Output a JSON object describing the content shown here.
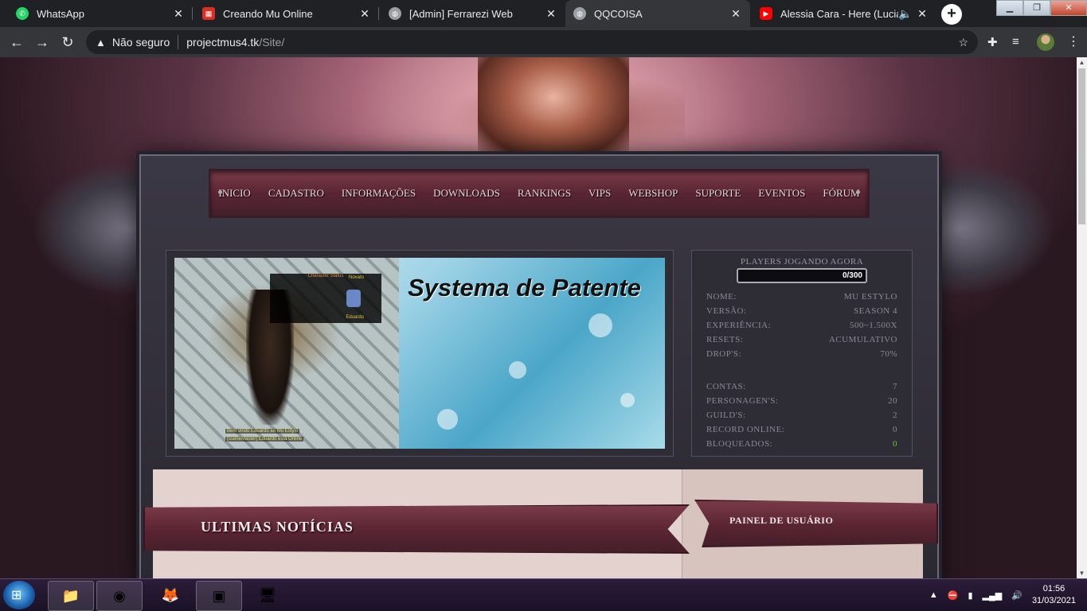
{
  "browser": {
    "tabs": [
      {
        "title": "WhatsApp",
        "icon": "whatsapp-icon",
        "color": "#25d366",
        "active": false
      },
      {
        "title": "Creando Mu Online",
        "icon": "calendar-icon",
        "color": "#d93025",
        "active": false
      },
      {
        "title": "[Admin] Ferrarezi Web",
        "icon": "globe-icon",
        "color": "#9aa0a6",
        "active": false
      },
      {
        "title": "QQCOISA",
        "icon": "globe-icon",
        "color": "#9aa0a6",
        "active": true
      },
      {
        "title": "Alessia Cara - Here (Lucian",
        "icon": "youtube-icon",
        "color": "#ff0000",
        "active": false
      }
    ],
    "address": {
      "security": "Não seguro",
      "host": "projectmus4.tk",
      "path": "/Site/"
    }
  },
  "site": {
    "nav": [
      "INICIO",
      "CADASTRO",
      "INFORMAÇÕES",
      "DOWNLOADS",
      "RANKINGS",
      "VIPS",
      "WEBSHOP",
      "SUPORTE",
      "EVENTOS",
      "FÓRUM"
    ],
    "banner": {
      "title": "Systema de Patente",
      "status_header": "Character Status",
      "rank": "Novato",
      "name": "Eduardo",
      "welcome": "Bem vindo Eduardo ao Mu Estylo",
      "welcome2": "[GameMaster] Eduardo está Online"
    },
    "players": {
      "label": "PLAYERS JOGANDO AGORA",
      "text": "0/300",
      "fraction": 0
    },
    "server_info": [
      {
        "label": "NOME:",
        "value": "MU ESTYLO"
      },
      {
        "label": "VERSÃO:",
        "value": "SEASON 4"
      },
      {
        "label": "EXPERIÊNCIA:",
        "value": "500~1.500X"
      },
      {
        "label": "RESETS:",
        "value": "ACUMULATIVO"
      },
      {
        "label": "DROP'S:",
        "value": "70%"
      }
    ],
    "stats": [
      {
        "label": "CONTAS:",
        "value": "7"
      },
      {
        "label": "PERSONAGEN'S:",
        "value": "20"
      },
      {
        "label": "GUILD'S:",
        "value": "2"
      },
      {
        "label": "RECORD ONLINE:",
        "value": "0"
      },
      {
        "label": "BLOQUEADOS:",
        "value": "0",
        "color": "#6ec23a"
      }
    ],
    "news_title": "ULTIMAS NOTÍCIAS",
    "panel_title": "PAINEL DE USUÁRIO"
  },
  "taskbar": {
    "apps": [
      "folder-icon",
      "chrome-icon",
      "firefox-icon",
      "camtasia-icon",
      "network-app-icon"
    ],
    "time": "01:56",
    "date": "31/03/2021"
  }
}
